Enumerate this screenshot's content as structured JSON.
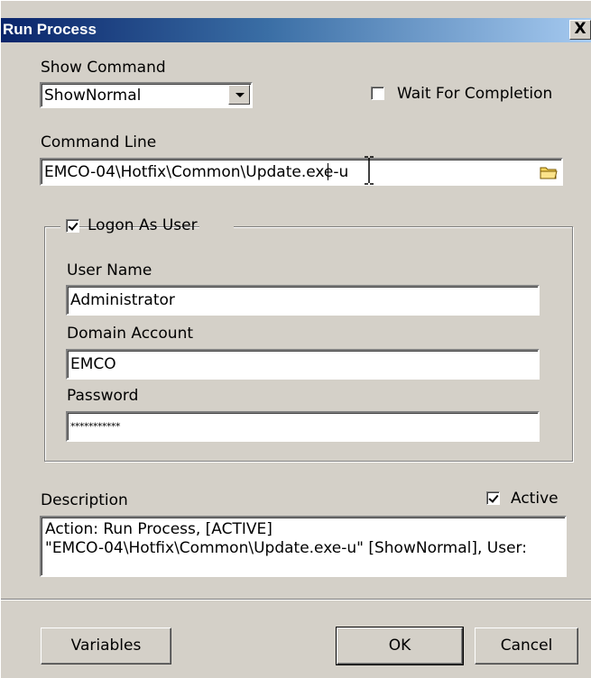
{
  "window": {
    "title": "Run Process",
    "close_glyph": "X"
  },
  "show_command": {
    "label": "Show Command",
    "value": "ShowNormal"
  },
  "wait_for_completion": {
    "label": "Wait For Completion",
    "checked": false
  },
  "command_line": {
    "label": "Command Line",
    "value": "EMCO-04\\Hotfix\\Common\\Update.exe-u"
  },
  "logon": {
    "label": "Logon As User",
    "checked": true,
    "user_name": {
      "label": "User Name",
      "value": "Administrator"
    },
    "domain_account": {
      "label": "Domain Account",
      "value": "EMCO"
    },
    "password": {
      "label": "Password",
      "value": "***********"
    }
  },
  "description": {
    "label": "Description",
    "line1": "Action: Run Process, [ACTIVE]",
    "line2": "\"EMCO-04\\Hotfix\\Common\\Update.exe-u\" [ShowNormal], User:"
  },
  "active": {
    "label": "Active",
    "checked": true
  },
  "buttons": {
    "variables": "Variables",
    "ok": "OK",
    "cancel": "Cancel"
  },
  "colors": {
    "dialog_bg": "#d4d0c8",
    "title_start": "#0a246a",
    "title_end": "#a6caf0",
    "folder_icon": "#f5d35a"
  }
}
